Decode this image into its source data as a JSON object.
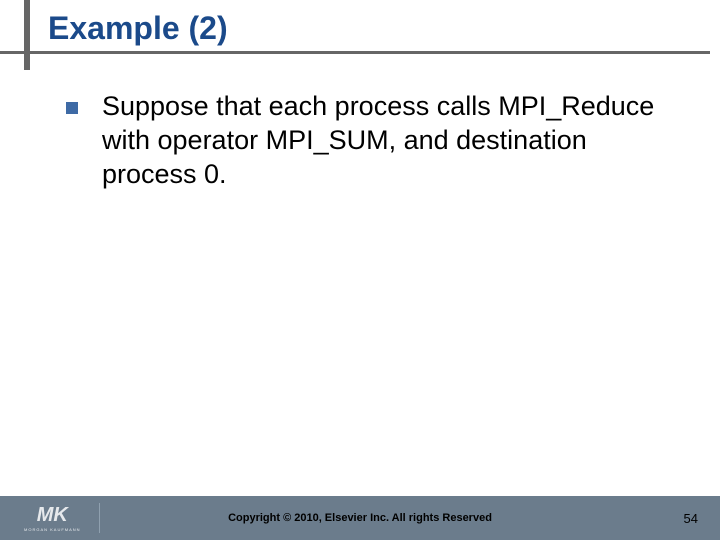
{
  "title": "Example (2)",
  "bullets": [
    "Suppose that each process calls MPI_Reduce with operator MPI_SUM, and destination process 0."
  ],
  "footer": {
    "logo_letters": "MK",
    "logo_sub": "MORGAN KAUFMANN",
    "copyright": "Copyright © 2010, Elsevier Inc. All rights Reserved",
    "page_number": "54"
  }
}
